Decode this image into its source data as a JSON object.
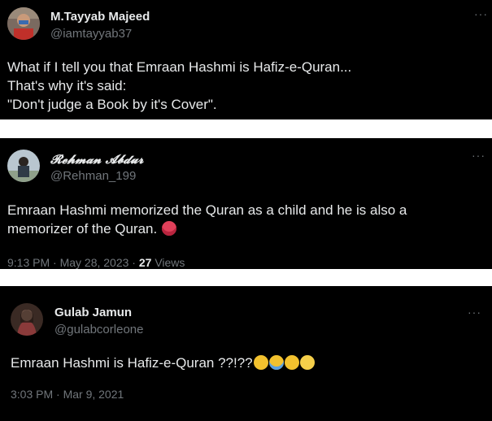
{
  "tweets": [
    {
      "name": "M.Tayyab Majeed",
      "handle": "@iamtayyab37",
      "lines": [
        "What if I tell you that Emraan Hashmi is Hafiz-e-Quran...",
        "That's why it's said:",
        "\"Don't judge a Book by it's Cover\"."
      ]
    },
    {
      "name": "𝓡𝓮𝓱𝓶𝓪𝓷 𝓐𝓫𝓭𝓾𝓻",
      "handle": "@Rehman_199",
      "lines": [
        "Emraan Hashmi memorized the Quran as a child and he is also a",
        "memorizer of the Quran."
      ],
      "time": "9:13 PM · May 28, 2023 · ",
      "views_count": "27",
      "views_label": " Views"
    },
    {
      "name": "Gulab Jamun",
      "handle": "@gulabcorleone",
      "lines": [
        "Emraan Hashmi is Hafiz-e-Quran ??!??"
      ],
      "time": "3:03 PM · Mar 9, 2021"
    }
  ],
  "icons": {
    "more": "more-horizontal-icon",
    "emoji_hot_face": "hot-face-emoji",
    "emoji_tears_of_joy": "tears-of-joy-emoji",
    "emoji_crying": "loudly-crying-emoji",
    "emoji_raised_eyebrow": "raised-eyebrow-emoji",
    "emoji_woozy": "woozy-face-emoji"
  },
  "colors": {
    "background": "#000000",
    "text": "#e7e9ea",
    "secondary": "#71767b"
  }
}
